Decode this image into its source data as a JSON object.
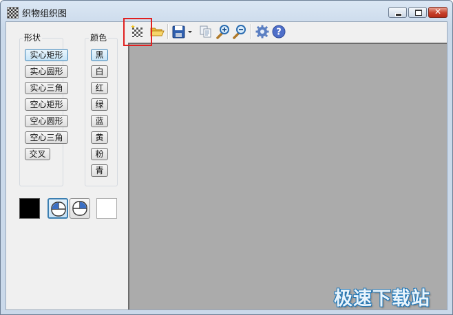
{
  "window": {
    "title": "织物组织图",
    "min_glyph": "",
    "max_glyph": "",
    "close_glyph": "✕"
  },
  "shape_panel": {
    "title": "形状",
    "items": [
      {
        "label": "实心矩形",
        "selected": true
      },
      {
        "label": "实心圆形",
        "selected": false
      },
      {
        "label": "实心三角",
        "selected": false
      },
      {
        "label": "空心矩形",
        "selected": false
      },
      {
        "label": "空心圆形",
        "selected": false
      },
      {
        "label": "空心三角",
        "selected": false
      },
      {
        "label": "交叉",
        "selected": false
      }
    ]
  },
  "color_panel": {
    "title": "颜色",
    "items": [
      {
        "label": "黑",
        "selected": true
      },
      {
        "label": "白",
        "selected": false
      },
      {
        "label": "红",
        "selected": false
      },
      {
        "label": "绿",
        "selected": false
      },
      {
        "label": "蓝",
        "selected": false
      },
      {
        "label": "黄",
        "selected": false
      },
      {
        "label": "粉",
        "selected": false
      },
      {
        "label": "青",
        "selected": false
      }
    ]
  },
  "bottom_controls": {
    "primary_color": "#000000",
    "secondary_color": "#ffffff",
    "left_mouse_selected": true
  },
  "toolbar": {
    "icons": [
      "new-pattern-icon",
      "open-folder-icon",
      "save-icon",
      "dropdown-arrow-icon",
      "copy-icon",
      "zoom-in-icon",
      "zoom-out-icon",
      "settings-gear-icon",
      "help-icon"
    ]
  },
  "canvas": {
    "background": "#ababab"
  },
  "watermark": {
    "text": "极速下载站"
  }
}
